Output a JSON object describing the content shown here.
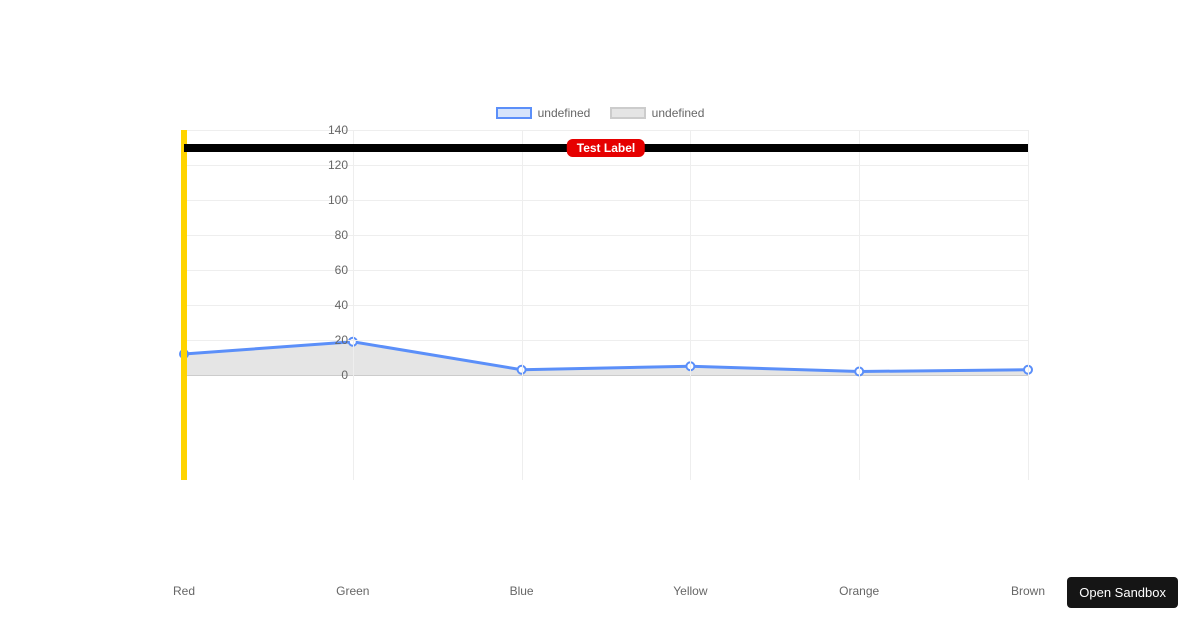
{
  "chart_data": {
    "type": "line",
    "categories": [
      "Red",
      "Green",
      "Blue",
      "Yellow",
      "Orange",
      "Brown"
    ],
    "series": [
      {
        "name": "undefined",
        "values": [
          12,
          19,
          3,
          5,
          2,
          3
        ],
        "color_border": "#5b8ff9",
        "color_fill": "#d6e4fb"
      },
      {
        "name": "undefined",
        "values": [
          12,
          19,
          3,
          5,
          2,
          3
        ],
        "color_border": "#cccccc",
        "color_fill": "#e5e5e5"
      }
    ],
    "ylim": [
      -60,
      140
    ],
    "yticks": [
      0,
      20,
      40,
      60,
      80,
      100,
      120,
      140
    ],
    "grid": true,
    "legend_position": "top",
    "annotations": {
      "hline": {
        "y": 130,
        "label": "Test Label",
        "line_color": "#000000",
        "label_bg": "#e60000",
        "label_fg": "#ffffff"
      },
      "vline": {
        "x_index": 0,
        "color": "#ffd400"
      }
    }
  },
  "legend": {
    "items": [
      {
        "label": "undefined",
        "border": "#5b8ff9",
        "fill": "#d6e4fb"
      },
      {
        "label": "undefined",
        "border": "#cccccc",
        "fill": "#e5e5e5"
      }
    ]
  },
  "button": {
    "open_sandbox": "Open Sandbox"
  }
}
